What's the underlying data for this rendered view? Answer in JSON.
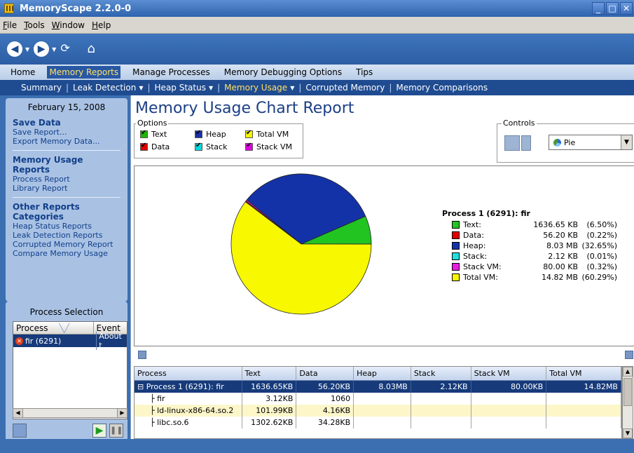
{
  "window": {
    "title": "MemoryScape 2.2.0-0"
  },
  "menubar": [
    "File",
    "Tools",
    "Window",
    "Help"
  ],
  "main_tabs": [
    {
      "label": "Home",
      "active": false
    },
    {
      "label": "Memory Reports",
      "active": true
    },
    {
      "label": "Manage Processes",
      "active": false
    },
    {
      "label": "Memory Debugging Options",
      "active": false
    },
    {
      "label": "Tips",
      "active": false
    }
  ],
  "subnav": [
    {
      "label": "Summary",
      "active": false,
      "dropdown": false
    },
    {
      "label": "Leak Detection",
      "active": false,
      "dropdown": true
    },
    {
      "label": "Heap Status",
      "active": false,
      "dropdown": true
    },
    {
      "label": "Memory Usage",
      "active": true,
      "dropdown": true
    },
    {
      "label": "Corrupted Memory",
      "active": false,
      "dropdown": false
    },
    {
      "label": "Memory Comparisons",
      "active": false,
      "dropdown": false
    }
  ],
  "sidebar": {
    "date": "February 15, 2008",
    "save_head": "Save Data",
    "save_links": [
      "Save Report...",
      "Export Memory Data..."
    ],
    "usage_head": "Memory Usage Reports",
    "usage_links": [
      "Process Report",
      "Library Report"
    ],
    "other_head": "Other Reports Categories",
    "other_links": [
      "Heap Status Reports",
      "Leak Detection Reports",
      "Corrupted Memory Report",
      "Compare Memory Usage"
    ]
  },
  "process_selection": {
    "title": "Process Selection",
    "col_process": "Process",
    "col_event": "Event",
    "row_process": "fir (6291)",
    "row_event": "About t"
  },
  "report": {
    "title": "Memory Usage Chart Report",
    "options_label": "Options",
    "controls_label": "Controls",
    "chart_type_selected": "Pie",
    "options": [
      {
        "label": "Text",
        "color": "#1eb400"
      },
      {
        "label": "Heap",
        "color": "#1a2fa8"
      },
      {
        "label": "Total VM",
        "color": "#f4f400"
      },
      {
        "label": "Data",
        "color": "#e00000"
      },
      {
        "label": "Stack",
        "color": "#00d8d8"
      },
      {
        "label": "Stack VM",
        "color": "#e000e0"
      }
    ]
  },
  "chart_data": {
    "type": "pie",
    "title": "Process 1 (6291): fir",
    "slices": [
      {
        "name": "Text:",
        "size": "1636.65 KB",
        "percent": 6.5,
        "pct_label": "(6.50%)",
        "color": "#22c422"
      },
      {
        "name": "Data:",
        "size": "56.20 KB",
        "percent": 0.22,
        "pct_label": "(0.22%)",
        "color": "#e00000"
      },
      {
        "name": "Heap:",
        "size": "8.03 MB",
        "percent": 32.65,
        "pct_label": "(32.65%)",
        "color": "#1432a8"
      },
      {
        "name": "Stack:",
        "size": "2.12 KB",
        "percent": 0.01,
        "pct_label": "(0.01%)",
        "color": "#22dede"
      },
      {
        "name": "Stack VM:",
        "size": "80.00 KB",
        "percent": 0.32,
        "pct_label": "(0.32%)",
        "color": "#ea1ce0"
      },
      {
        "name": "Total VM:",
        "size": "14.82 MB",
        "percent": 60.29,
        "pct_label": "(60.29%)",
        "color": "#f8f800"
      }
    ]
  },
  "table": {
    "headers": [
      "Process",
      "Text",
      "Data",
      "Heap",
      "Stack",
      "Stack VM",
      "Total VM"
    ],
    "rows": [
      {
        "cells": [
          "Process 1 (6291): fir",
          "1636.65KB",
          "56.20KB",
          "8.03MB",
          "2.12KB",
          "80.00KB",
          "14.82MB"
        ],
        "selected": true,
        "alt": false,
        "prefix": "⊟"
      },
      {
        "cells": [
          "fir",
          "3.12KB",
          "1060",
          "",
          "",
          "",
          ""
        ],
        "selected": false,
        "alt": false,
        "prefix": "├"
      },
      {
        "cells": [
          "ld-linux-x86-64.so.2",
          "101.99KB",
          "4.16KB",
          "",
          "",
          "",
          ""
        ],
        "selected": false,
        "alt": true,
        "prefix": "├"
      },
      {
        "cells": [
          "libc.so.6",
          "1302.62KB",
          "34.28KB",
          "",
          "",
          "",
          ""
        ],
        "selected": false,
        "alt": false,
        "prefix": "├"
      }
    ]
  }
}
